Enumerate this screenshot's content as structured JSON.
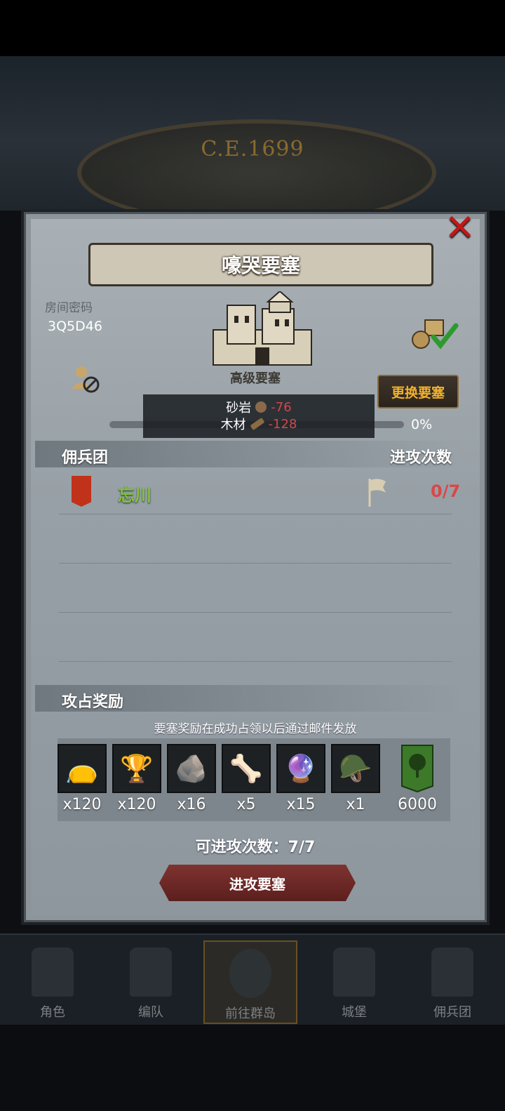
{
  "background": {
    "era_text": "C.E.1699"
  },
  "panel": {
    "title": "嚎哭要塞",
    "room_code_label": "房间密码",
    "room_code": "3Q5D46",
    "fortress_grade": "高级要塞",
    "change_button": "更换要塞",
    "tooltip": {
      "line1_label": "砂岩",
      "line1_value": "-76",
      "line2_label": "木材",
      "line2_value": "-128"
    },
    "progress_percent": "0%",
    "progress_fraction": 0
  },
  "mercenary": {
    "section_title": "佣兵团",
    "attempts_title": "进攻次数",
    "rows": [
      {
        "name": "忘川",
        "attempts": "0/7"
      }
    ]
  },
  "rewards": {
    "section_title": "攻占奖励",
    "note": "要塞奖励在成功占领以后通过邮件发放",
    "items": [
      {
        "icon": "sack-icon",
        "qty": "x120"
      },
      {
        "icon": "goblet-icon",
        "qty": "x120"
      },
      {
        "icon": "ore-icon",
        "qty": "x16"
      },
      {
        "icon": "horn-icon",
        "qty": "x5"
      },
      {
        "icon": "purple-crystal-icon",
        "qty": "x15"
      },
      {
        "icon": "helmet-medal-icon",
        "qty": "x1"
      },
      {
        "icon": "tree-banner-icon",
        "qty": "6000"
      }
    ],
    "remaining_label": "可进攻次数：7/7",
    "attack_button": "进攻要塞"
  },
  "bottom_nav": [
    {
      "label": "角色"
    },
    {
      "label": "编队"
    },
    {
      "label": "前往群岛"
    },
    {
      "label": "城堡"
    },
    {
      "label": "佣兵团"
    }
  ],
  "colors": {
    "close": "#c01818",
    "merc_name": "#7fc43a",
    "attempts": "#d94848",
    "accent_button": "#f2b12e"
  }
}
